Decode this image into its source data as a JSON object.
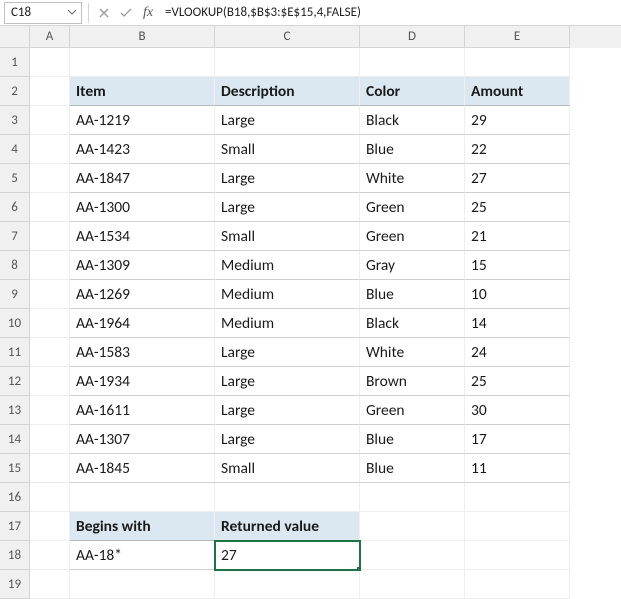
{
  "name_box": {
    "value": "C18"
  },
  "formula_bar": {
    "value": "=VLOOKUP(B18,$B$3:$E$15,4,FALSE)"
  },
  "columns": [
    "A",
    "B",
    "C",
    "D",
    "E"
  ],
  "rows_visible": 19,
  "selected_cell": "C18",
  "table1": {
    "header_row": 2,
    "start_col": "B",
    "headers": [
      "Item",
      "Description",
      "Color",
      "Amount"
    ],
    "rows": [
      {
        "item": "AA-1219",
        "desc": "Large",
        "color": "Black",
        "amount": "29"
      },
      {
        "item": "AA-1423",
        "desc": "Small",
        "color": "Blue",
        "amount": "22"
      },
      {
        "item": "AA-1847",
        "desc": "Large",
        "color": "White",
        "amount": "27"
      },
      {
        "item": "AA-1300",
        "desc": "Large",
        "color": "Green",
        "amount": "25"
      },
      {
        "item": "AA-1534",
        "desc": "Small",
        "color": "Green",
        "amount": "21"
      },
      {
        "item": "AA-1309",
        "desc": "Medium",
        "color": "Gray",
        "amount": "15"
      },
      {
        "item": "AA-1269",
        "desc": "Medium",
        "color": "Blue",
        "amount": "10"
      },
      {
        "item": "AA-1964",
        "desc": "Medium",
        "color": "Black",
        "amount": "14"
      },
      {
        "item": "AA-1583",
        "desc": "Large",
        "color": "White",
        "amount": "24"
      },
      {
        "item": "AA-1934",
        "desc": "Large",
        "color": "Brown",
        "amount": "25"
      },
      {
        "item": "AA-1611",
        "desc": "Large",
        "color": "Green",
        "amount": "30"
      },
      {
        "item": "AA-1307",
        "desc": "Large",
        "color": "Blue",
        "amount": "17"
      },
      {
        "item": "AA-1845",
        "desc": "Small",
        "color": "Blue",
        "amount": "11"
      }
    ]
  },
  "table2": {
    "header_row": 17,
    "headers": [
      "Begins with",
      "Returned value"
    ],
    "row": {
      "begins": "AA-18*",
      "value": "27"
    }
  }
}
